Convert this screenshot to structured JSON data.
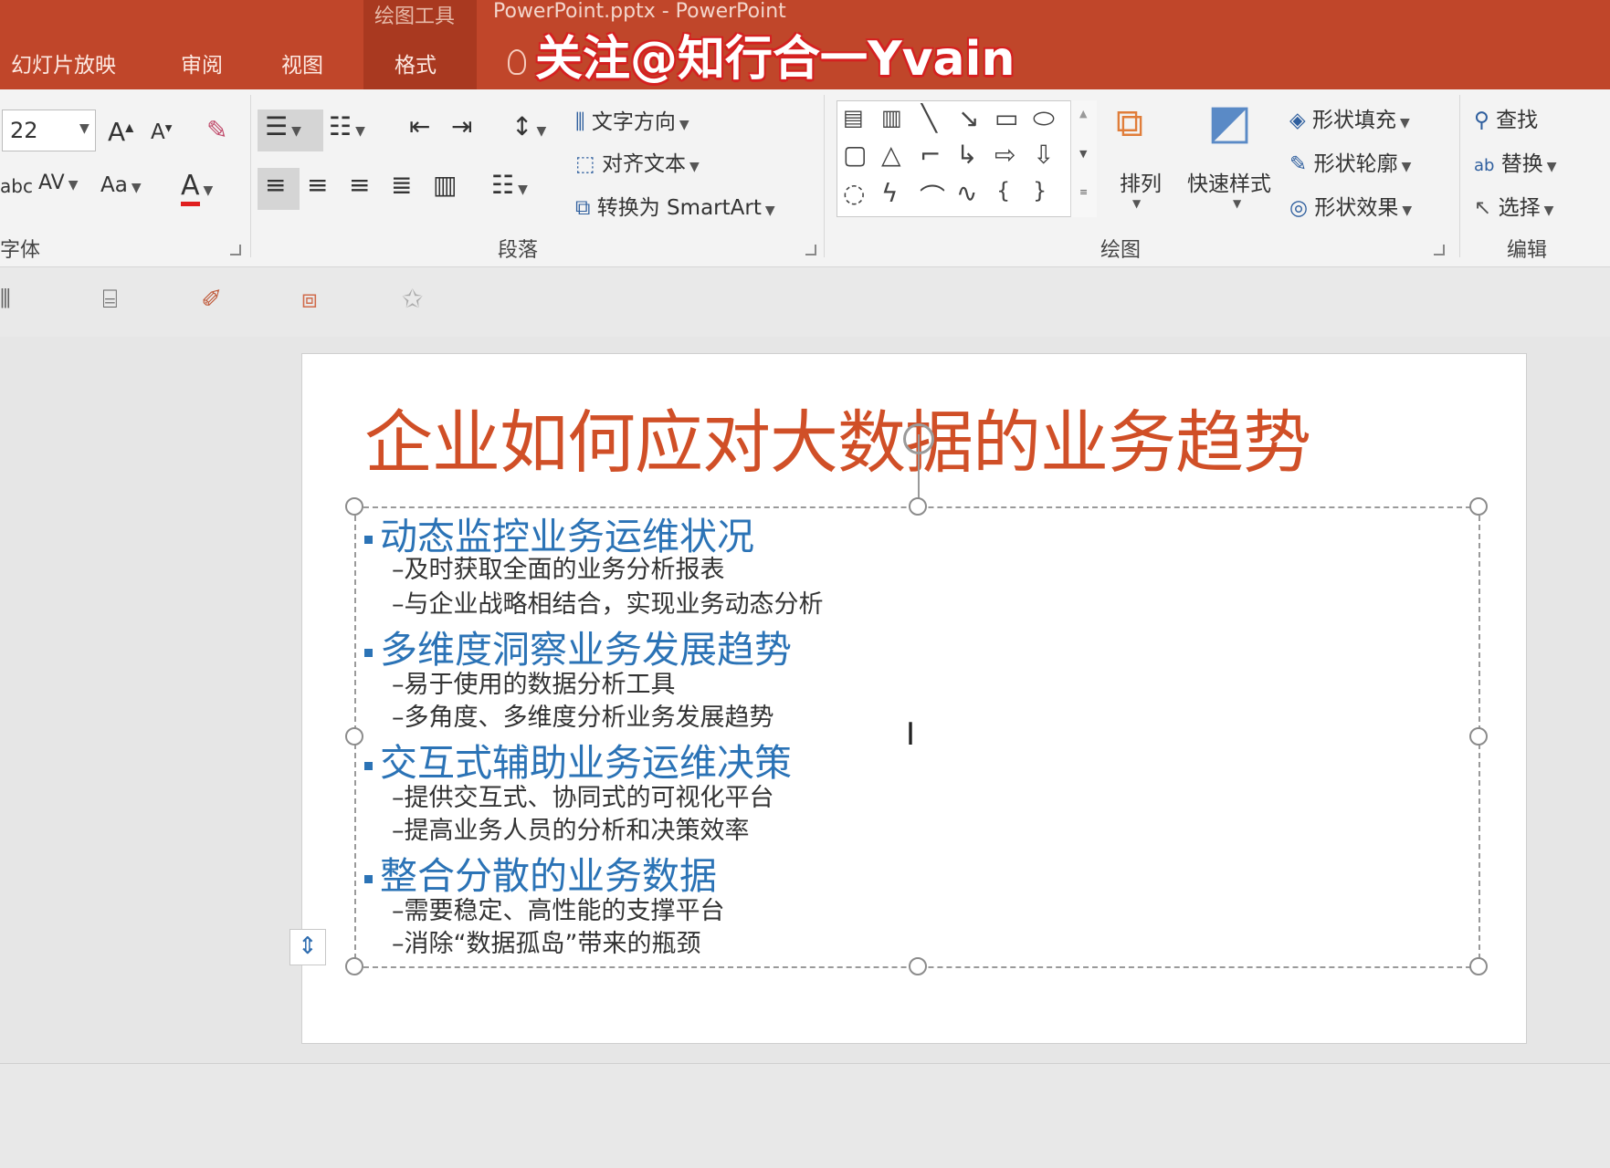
{
  "titlebar": {
    "context_label": "绘图工具",
    "doc_title": "PowerPoint.pptx - PowerPoint",
    "tabs": [
      "幻灯片放映",
      "审阅",
      "视图",
      "格式"
    ],
    "watermark": "关注@知行合一Yvain"
  },
  "ribbon": {
    "font": {
      "size": "22",
      "grow": "A",
      "shrink": "A",
      "spacing": "AV",
      "case": "Aa",
      "color_letter": "A",
      "strike": "abc",
      "group_label": "字体"
    },
    "paragraph": {
      "text_direction": "文字方向",
      "align_text": "对齐文本",
      "convert_smartart": "转换为 SmartArt",
      "group_label": "段落"
    },
    "drawing": {
      "arrange": "排列",
      "quick_styles": "快速样式",
      "shape_fill": "形状填充",
      "shape_outline": "形状轮廓",
      "shape_effects": "形状效果",
      "group_label": "绘图"
    },
    "editing": {
      "find": "查找",
      "replace": "替换",
      "select": "选择",
      "group_label": "编辑"
    }
  },
  "slide": {
    "title": "企业如何应对大数据的业务趋势",
    "bullets": [
      {
        "text": "动态监控业务运维状况",
        "subs": [
          "–及时获取全面的业务分析报表",
          "–与企业战略相结合，实现业务动态分析"
        ]
      },
      {
        "text": "多维度洞察业务发展趋势",
        "subs": [
          "–易于使用的数据分析工具",
          "–多角度、多维度分析业务发展趋势"
        ]
      },
      {
        "text": "交互式辅助业务运维决策",
        "subs": [
          "–提供交互式、协同式的可视化平台",
          "–提高业务人员的分析和决策效率"
        ]
      },
      {
        "text": "整合分散的业务数据",
        "subs": [
          "–需要稳定、高性能的支撑平台",
          "–消除“数据孤岛”带来的瓶颈"
        ]
      }
    ]
  },
  "colors": {
    "title_bar": "#c0462a",
    "slide_title": "#d04f27",
    "bullet_blue": "#2b73b6"
  }
}
